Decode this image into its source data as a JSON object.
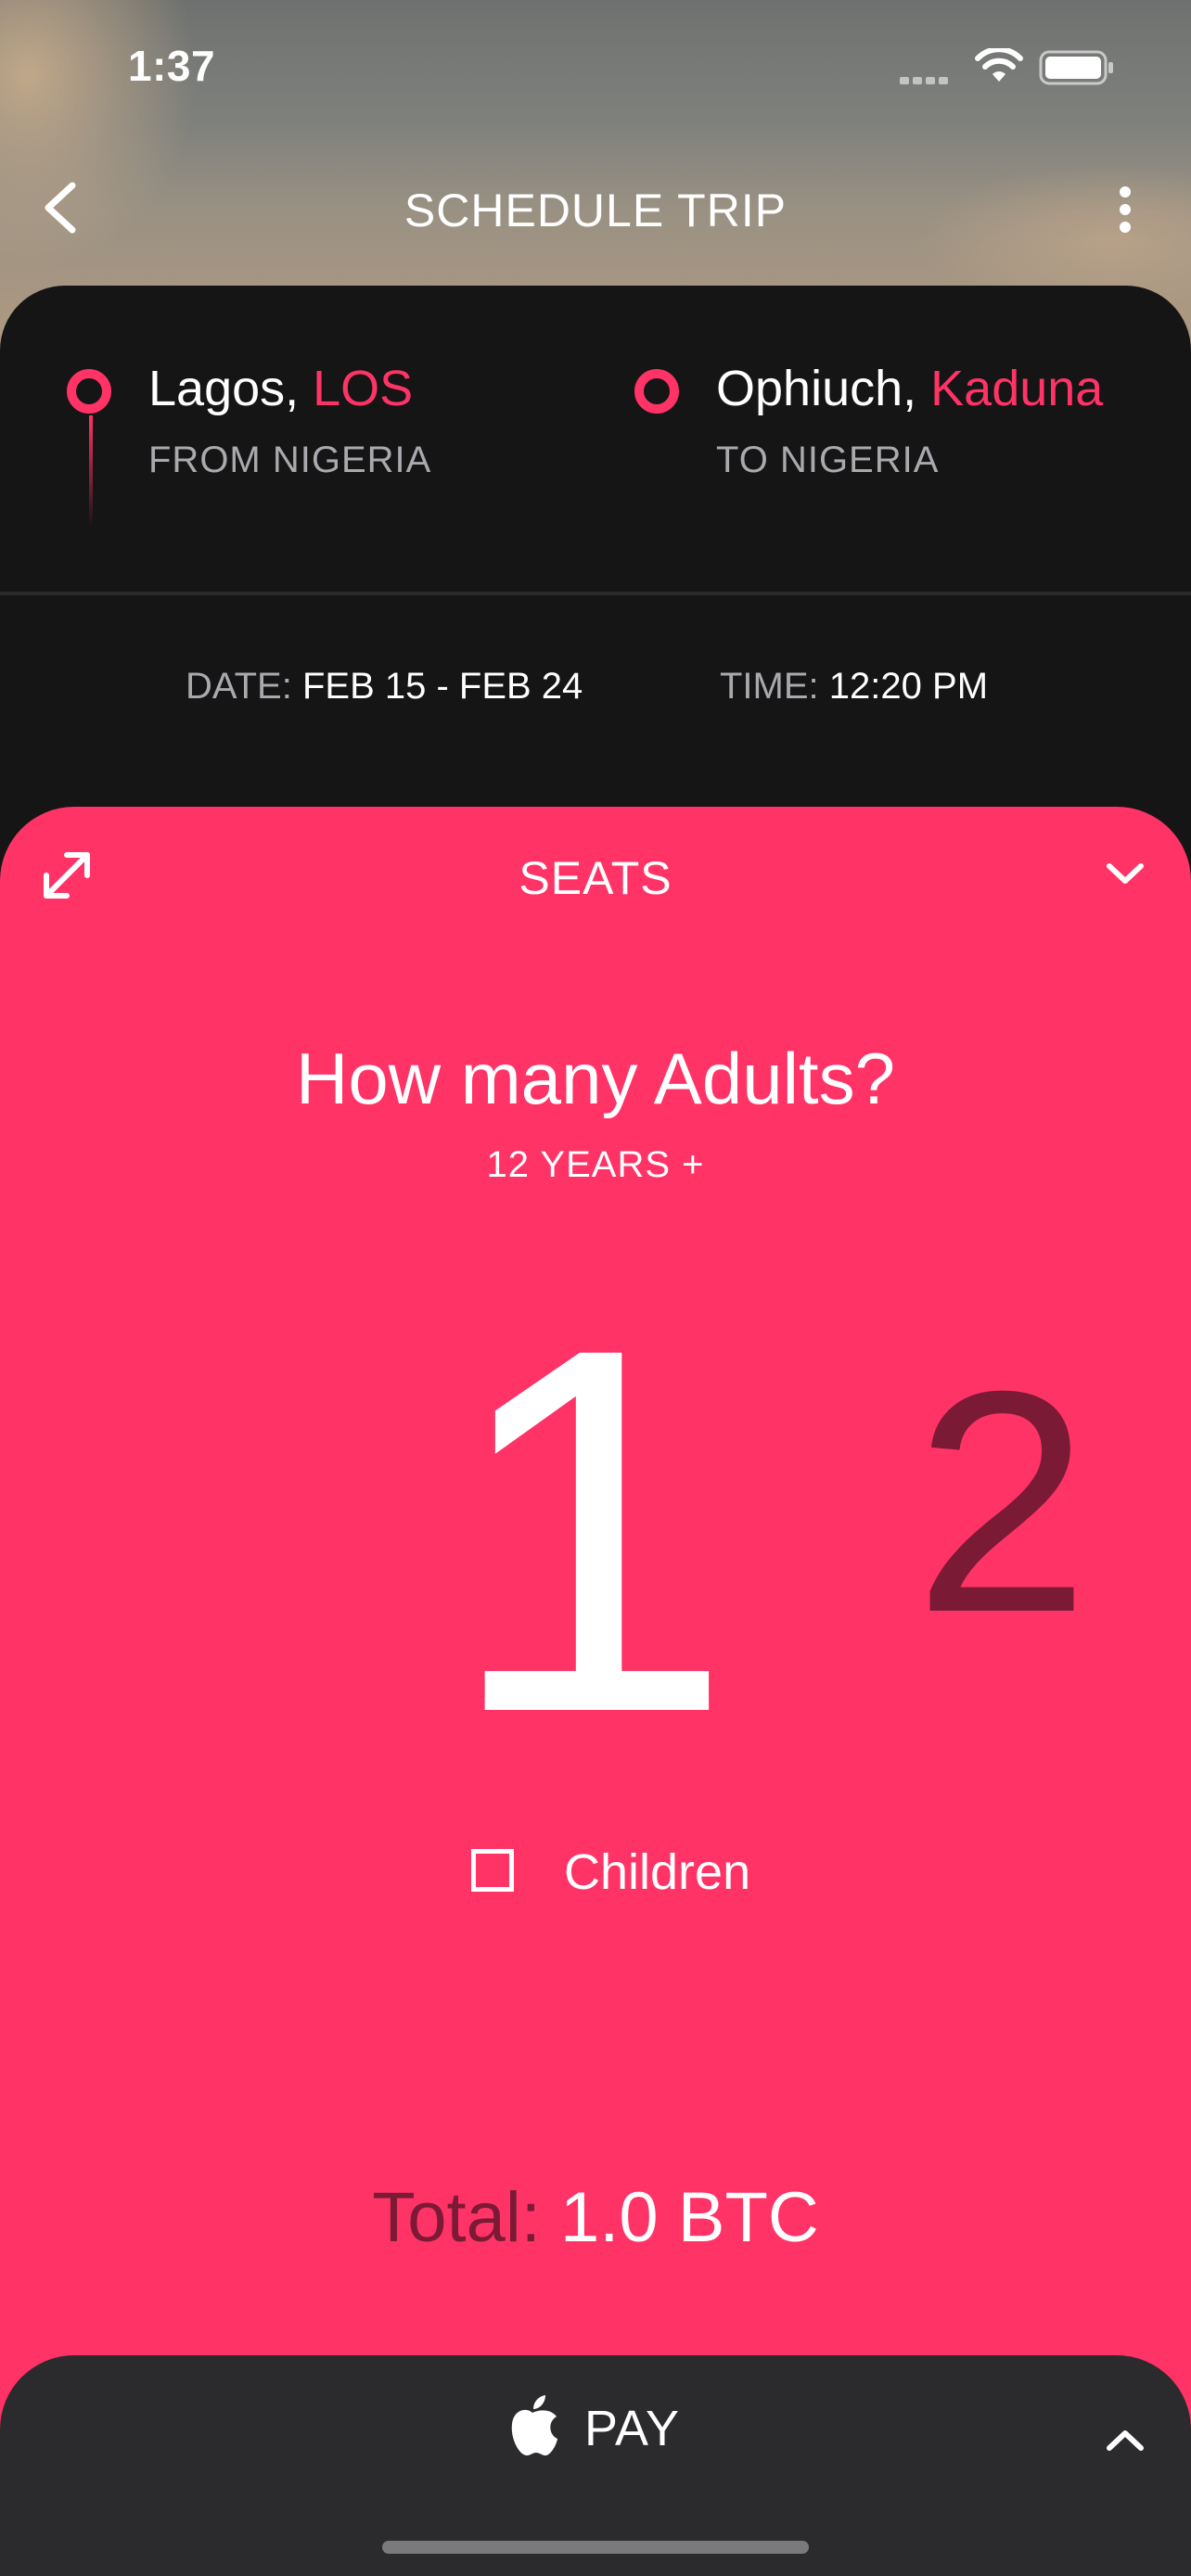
{
  "status_bar": {
    "time": "1:37"
  },
  "nav": {
    "title": "SCHEDULE TRIP"
  },
  "route": {
    "from": {
      "city": "Lagos, ",
      "code": "LOS",
      "label": "FROM NIGERIA"
    },
    "to": {
      "city": "Ophiuch, ",
      "code": "Kaduna",
      "label": "TO NIGERIA"
    }
  },
  "schedule": {
    "date_label": "DATE:",
    "date_value": "FEB 15 - FEB 24",
    "time_label": "TIME:",
    "time_value": "12:20 PM"
  },
  "seats": {
    "title": "SEATS",
    "question": "How many Adults?",
    "age_note": "12 YEARS +",
    "current_value": "1",
    "next_value": "2",
    "children_label": "Children",
    "children_checked": false,
    "total_label": "Total:",
    "total_value": "1.0 BTC"
  },
  "pay": {
    "label": "PAY"
  },
  "colors": {
    "accent": "#ff3366",
    "dark": "#151516",
    "pay_bar": "#2b2b2d",
    "muted_accent": "#7a1a34"
  },
  "icons": [
    "back-chevron-icon",
    "more-vertical-icon",
    "expand-diagonal-icon",
    "chevron-down-icon",
    "apple-icon",
    "chevron-up-icon",
    "wifi-icon",
    "battery-icon",
    "cellular-signal-icon"
  ]
}
